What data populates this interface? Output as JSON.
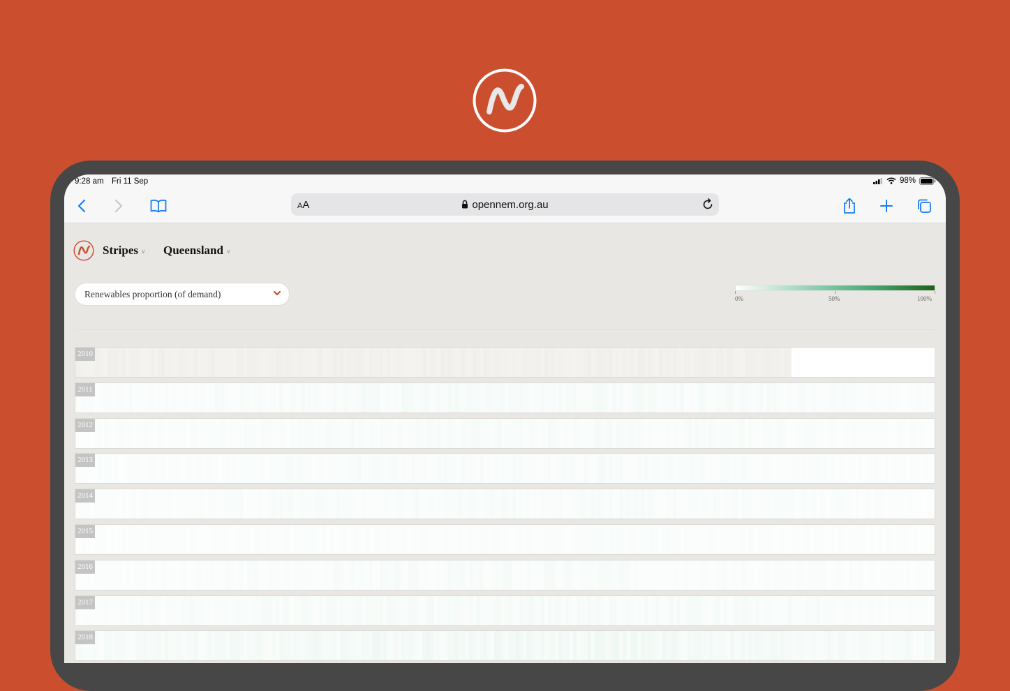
{
  "status_bar": {
    "time": "9:28 am",
    "date": "Fri 11 Sep",
    "battery": "98%"
  },
  "browser": {
    "text_size_label_small": "A",
    "text_size_label_large": "A",
    "url": "opennem.org.au"
  },
  "app": {
    "nav": [
      {
        "label": "Stripes"
      },
      {
        "label": "Queensland"
      }
    ],
    "metric": {
      "selected": "Renewables proportion (of demand)"
    },
    "legend": {
      "labels": [
        "0%",
        "50%",
        "100%"
      ],
      "colors": [
        "#ffffff",
        "#7fc8a5",
        "#1f6116"
      ]
    }
  },
  "chart_data": {
    "type": "heatmap",
    "metric": "Renewables proportion (of demand)",
    "region": "Queensland",
    "color_scale": {
      "min": 0,
      "max": 100,
      "min_label": "0%",
      "mid_label": "50%",
      "max_label": "100%"
    },
    "rows": [
      {
        "year": "2010",
        "level": 0.0,
        "missing_until": 0.833
      },
      {
        "year": "2011",
        "level": 0.06
      },
      {
        "year": "2012",
        "level": 0.05
      },
      {
        "year": "2013",
        "level": 0.05
      },
      {
        "year": "2014",
        "level": 0.05
      },
      {
        "year": "2015",
        "level": 0.04
      },
      {
        "year": "2016",
        "level": 0.05
      },
      {
        "year": "2017",
        "level": 0.06
      },
      {
        "year": "2018",
        "level": 0.09
      }
    ]
  },
  "colors": {
    "background": "#cb4f2f",
    "device_frame": "#474747",
    "accent": "#c94b30",
    "safari_blue": "#1a7cf5"
  }
}
